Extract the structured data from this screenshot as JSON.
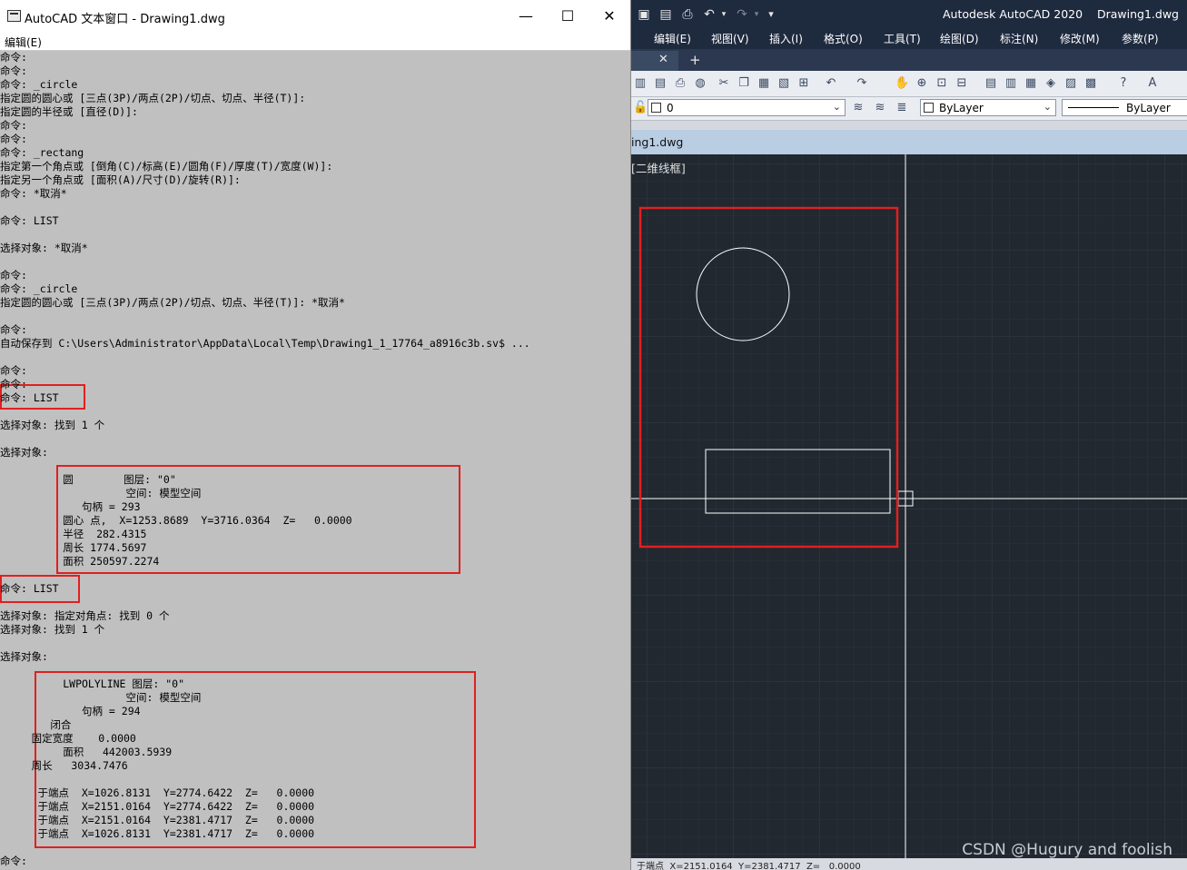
{
  "text_window": {
    "title": "AutoCAD 文本窗口 - Drawing1.dwg",
    "minimize": "—",
    "maximize": "☐",
    "close": "✕",
    "menu_edit": "编辑(E)",
    "lines": [
      "命令:",
      "命令:",
      "命令: _circle",
      "指定圆的圆心或 [三点(3P)/两点(2P)/切点、切点、半径(T)]:",
      "指定圆的半径或 [直径(D)]:",
      "命令:",
      "命令:",
      "命令: _rectang",
      "指定第一个角点或 [倒角(C)/标高(E)/圆角(F)/厚度(T)/宽度(W)]:",
      "指定另一个角点或 [面积(A)/尺寸(D)/旋转(R)]:",
      "命令: *取消*",
      "",
      "命令: LIST",
      "",
      "选择对象: *取消*",
      "",
      "命令:",
      "命令: _circle",
      "指定圆的圆心或 [三点(3P)/两点(2P)/切点、切点、半径(T)]: *取消*",
      "",
      "命令:",
      "自动保存到 C:\\Users\\Administrator\\AppData\\Local\\Temp\\Drawing1_1_17764_a8916c3b.sv$ ...",
      "",
      "命令:",
      "命令:",
      "命令: LIST",
      "",
      "选择对象: 找到 1 个",
      "",
      "选择对象:",
      "",
      "          圆        图层: \"0\"",
      "                    空间: 模型空间",
      "             句柄 = 293",
      "          圆心 点,  X=1253.8689  Y=3716.0364  Z=   0.0000",
      "          半径  282.4315",
      "          周长 1774.5697",
      "          面积 250597.2274",
      "",
      "命令: LIST",
      "",
      "选择对象: 指定对角点: 找到 0 个",
      "选择对象: 找到 1 个",
      "",
      "选择对象:",
      "",
      "          LWPOLYLINE 图层: \"0\"",
      "                    空间: 模型空间",
      "             句柄 = 294",
      "        闭合",
      "     固定宽度    0.0000",
      "          面积   442003.5939",
      "     周长   3034.7476",
      "",
      "      于端点  X=1026.8131  Y=2774.6422  Z=   0.0000",
      "      于端点  X=2151.0164  Y=2774.6422  Z=   0.0000",
      "      于端点  X=2151.0164  Y=2381.4717  Z=   0.0000",
      "      于端点  X=1026.8131  Y=2381.4717  Z=   0.0000",
      "",
      "命令:"
    ]
  },
  "acad": {
    "title": "Autodesk AutoCAD 2020    Drawing1.dwg",
    "quick_access_icons": [
      "new-file-icon",
      "save-icon",
      "saveas-icon",
      "print-icon",
      "undo-icon",
      "redo-icon",
      "dropdown-icon"
    ],
    "menus": [
      "编辑(E)",
      "视图(V)",
      "插入(I)",
      "格式(O)",
      "工具(T)",
      "绘图(D)",
      "标注(N)",
      "修改(M)",
      "参数(P)"
    ],
    "tab_close": "✕",
    "tab_add": "+",
    "layer_value": "0",
    "color_value": "ByLayer",
    "linetype_value": "ByLayer",
    "doc_tab": "ing1.dwg",
    "view_label": "[二维线框]",
    "watermark": "CSDN @Hugury and foolish",
    "status_text": "于端点  X=2151.0164  Y=2381.4717  Z=   0.0000",
    "colors": {
      "titlebar": "#1e2a3e",
      "canvas": "#212830",
      "highlight": "#e02020"
    }
  }
}
